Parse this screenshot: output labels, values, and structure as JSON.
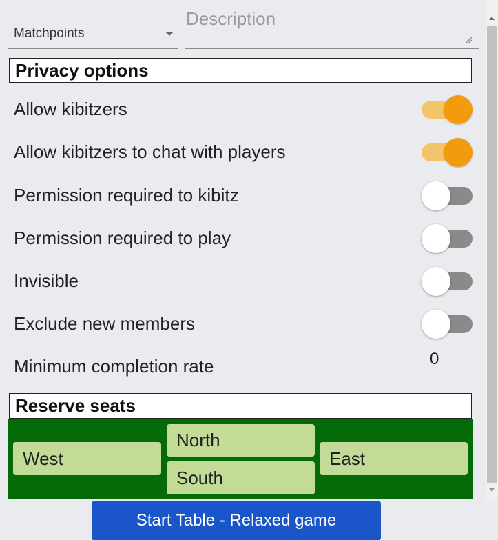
{
  "scoring_select": {
    "value": "Matchpoints"
  },
  "description": {
    "placeholder": "Description",
    "value": ""
  },
  "privacy": {
    "header": "Privacy options",
    "options": [
      {
        "label": "Allow kibitzers",
        "enabled": true
      },
      {
        "label": "Allow kibitzers to chat with players",
        "enabled": true
      },
      {
        "label": "Permission required to kibitz",
        "enabled": false
      },
      {
        "label": "Permission required to play",
        "enabled": false
      },
      {
        "label": "Invisible",
        "enabled": false
      },
      {
        "label": "Exclude new members",
        "enabled": false
      }
    ],
    "min_completion": {
      "label": "Minimum completion rate",
      "value": "0"
    }
  },
  "reserve": {
    "header": "Reserve seats",
    "seats": {
      "west": "West",
      "north": "North",
      "east": "East",
      "south": "South"
    }
  },
  "start_button": {
    "label": "Start Table - Relaxed game"
  },
  "colors": {
    "toggle_on_knob": "#f29b0d",
    "toggle_on_track": "#f3c46a",
    "toggle_off_track": "#8a8a8a",
    "seats_background": "#056b06",
    "seat_button": "#c2dc98",
    "primary_button": "#1a56c9"
  }
}
